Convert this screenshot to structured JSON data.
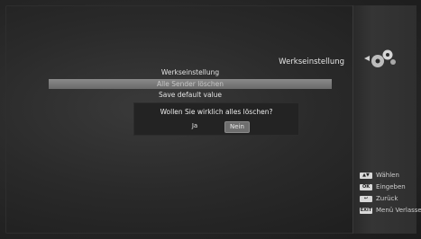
{
  "header": {
    "title": "Werkseinstellung",
    "icon": "gears-icon"
  },
  "menu": {
    "items": [
      {
        "label": "Werkseinstellung"
      },
      {
        "label": "Alle Sender löschen",
        "selected": true
      },
      {
        "label": "Save default value"
      }
    ]
  },
  "dialog": {
    "message": "Wollen Sie wirklich alles löschen?",
    "yes_label": "Ja",
    "no_label": "Nein",
    "focused": "no"
  },
  "legend": {
    "items": [
      {
        "key": "up-down-icon",
        "label": "Wählen"
      },
      {
        "key": "ok-icon",
        "key_text": "OK",
        "label": "Eingeben"
      },
      {
        "key": "back-icon",
        "label": "Zurück"
      },
      {
        "key": "exit-icon",
        "key_text": "EXIT",
        "label": "Menü Verlassen"
      }
    ]
  }
}
